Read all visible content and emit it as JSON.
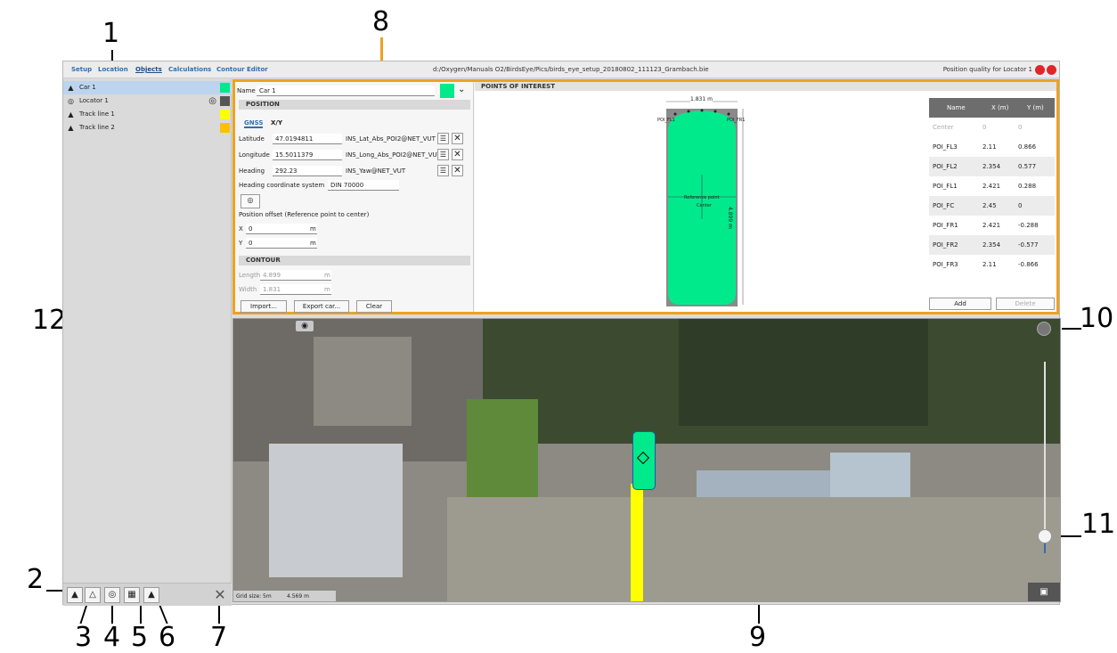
{
  "callouts": [
    "1",
    "2",
    "3",
    "4",
    "5",
    "6",
    "7",
    "8",
    "9",
    "10",
    "11",
    "12"
  ],
  "topbar": {
    "tabs": [
      "Setup",
      "Location",
      "Objects",
      "Calculations",
      "Contour Editor"
    ],
    "active_tab": "Objects",
    "file_path": "d:/Oxygen/Manuals O2/BirdsEye/Pics/birds_eye_setup_20180802_111123_Grambach.bie",
    "quality_label": "Position quality for Locator 1"
  },
  "objects": [
    {
      "label": "Car 1",
      "icon": "car-icon",
      "color": "#00ea8c"
    },
    {
      "label": "Locator 1",
      "icon": "locator-icon",
      "color": "#555555"
    },
    {
      "label": "Track line 1",
      "icon": "track-line-icon",
      "color": "#ffff00"
    },
    {
      "label": "Track line 2",
      "icon": "track-line-icon",
      "color": "#ffc000"
    }
  ],
  "settings": {
    "name_label": "Name",
    "name_value": "Car 1",
    "position_header": "POSITION",
    "subtab_gnss": "GNSS",
    "subtab_xy": "X/Y",
    "latitude_label": "Latitude",
    "latitude_value": "47.0194811",
    "latitude_channel": "INS_Lat_Abs_POI2@NET_VUT",
    "longitude_label": "Longitude",
    "longitude_value": "15.5011379",
    "longitude_channel": "INS_Long_Abs_POI2@NET_VUT",
    "heading_label": "Heading",
    "heading_value": "292.23",
    "heading_channel": "INS_Yaw@NET_VUT",
    "heading_cs_label": "Heading coordinate system",
    "heading_cs_value": "DIN 70000",
    "offset_label": "Position offset (Reference point to center)",
    "x_label": "X",
    "x_value": "0",
    "y_label": "Y",
    "y_value": "0",
    "unit_m": "m",
    "contour_header": "CONTOUR",
    "length_label": "Length",
    "length_value": "4.899",
    "width_label": "Width",
    "width_value": "1.831",
    "import_button": "Import...",
    "export_button": "Export car...",
    "clear_button": "Clear"
  },
  "poi": {
    "header": "POINTS OF INTEREST",
    "width_dim": "1.831 m",
    "length_dim": "4.899 m",
    "ref_label": "Reference point",
    "center_label": "Center",
    "label_fl": "POI_FL1",
    "label_fr": "POI_FR1",
    "columns": [
      "Name",
      "X (m)",
      "Y (m)"
    ],
    "rows": [
      {
        "name": "Center",
        "x": "0",
        "y": "0"
      },
      {
        "name": "POI_FL3",
        "x": "2.11",
        "y": "0.866"
      },
      {
        "name": "POI_FL2",
        "x": "2.354",
        "y": "0.577"
      },
      {
        "name": "POI_FL1",
        "x": "2.421",
        "y": "0.288"
      },
      {
        "name": "POI_FC",
        "x": "2.45",
        "y": "0"
      },
      {
        "name": "POI_FR1",
        "x": "2.421",
        "y": "-0.288"
      },
      {
        "name": "POI_FR2",
        "x": "2.354",
        "y": "-0.577"
      },
      {
        "name": "POI_FR3",
        "x": "2.11",
        "y": "-0.866"
      }
    ],
    "add_button": "Add",
    "delete_button": "Delete"
  },
  "map": {
    "grid_label": "Grid size: 5m",
    "scale_value": "4.569 m",
    "zoom_level": 0.2
  },
  "colors": {
    "accent": "#2f6fb0",
    "highlight": "#f0a020",
    "car": "#00ea8c",
    "track": "#ffff00",
    "status_red": "#e0262a"
  }
}
